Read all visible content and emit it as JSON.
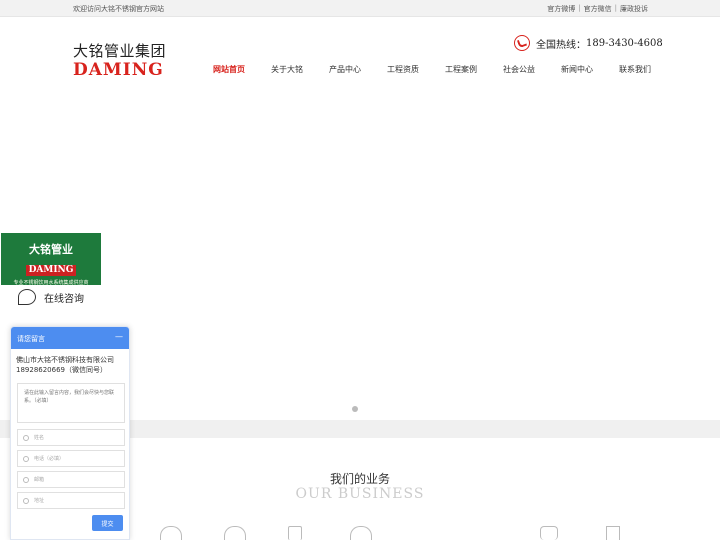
{
  "topbar": {
    "welcome": "欢迎访问大铭不锈钢官方网站",
    "links": [
      "官方微博",
      "官方微信",
      "廉政投诉"
    ]
  },
  "logo": {
    "cn": "大铭管业集团",
    "en": "DAMING"
  },
  "hotline": {
    "label": "全国热线：",
    "number": "189-3430-4608"
  },
  "nav": {
    "items": [
      "网站首页",
      "关于大铭",
      "产品中心",
      "工程资质",
      "工程案例",
      "社会公益",
      "新闻中心",
      "联系我们"
    ],
    "active_index": 0
  },
  "side_badge": {
    "title": "大铭管业",
    "en": "DAMING",
    "slogan": "专业不锈钢饮用水系统集成供应商"
  },
  "consult": {
    "label": "在线咨询"
  },
  "message_panel": {
    "header": "请您留言",
    "minimize": "—",
    "company": "佛山市大铭不锈钢科技有限公司",
    "phone": "18928620669（微信同号）",
    "textarea_placeholder": "请在此输入留言内容，我们会尽快与您联系。（必填）",
    "fields": [
      {
        "placeholder": "姓名",
        "icon": "user-icon"
      },
      {
        "placeholder": "电话（必填）",
        "icon": "phone-icon"
      },
      {
        "placeholder": "邮箱",
        "icon": "mail-icon"
      },
      {
        "placeholder": "地址",
        "icon": "location-icon"
      }
    ],
    "submit": "提交"
  },
  "business": {
    "title": "我们的业务",
    "subtitle": "OUR BUSINESS"
  },
  "colors": {
    "accent": "#d8231d",
    "panel_blue": "#4d8df0",
    "badge_green": "#1e7a3c"
  }
}
